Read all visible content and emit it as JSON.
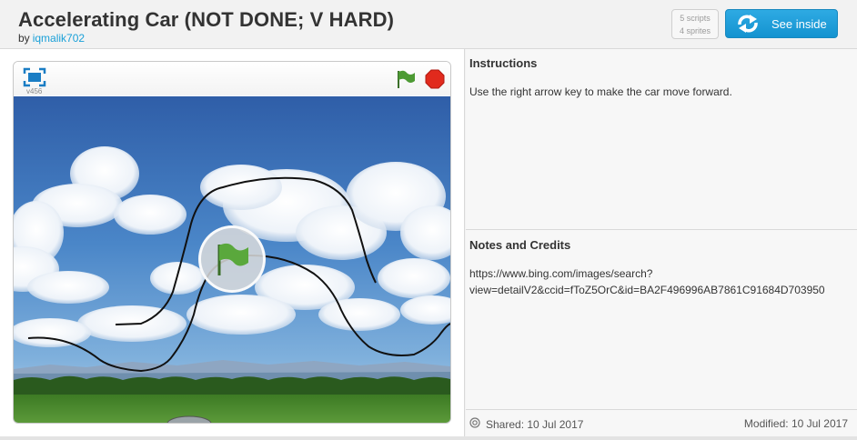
{
  "project": {
    "title": "Accelerating Car (NOT DONE; V HARD)",
    "by_label": "by",
    "author": "iqmalik702",
    "scripts_count": "5 scripts",
    "sprites_count": "4 sprites",
    "see_inside_label": "See inside"
  },
  "player": {
    "version": "v456",
    "icons": {
      "fullscreen": "fullscreen-icon",
      "green_flag": "green-flag-icon",
      "stop": "stop-icon",
      "big_flag": "big-green-flag-icon"
    },
    "colors": {
      "sky_top": "#3e6fb8",
      "grass": "#4f8a2c",
      "flag": "#5aa83c",
      "stop": "#e12a1d"
    }
  },
  "instructions": {
    "title": "Instructions",
    "body": "Use the right arrow key to make the car move forward."
  },
  "notes": {
    "title": "Notes and Credits",
    "line1": "https://www.bing.com/images/search?",
    "line2": "view=detailV2&ccid=fToZ5OrC&id=BA2F496996AB7861C91684D703950"
  },
  "footer": {
    "shared": "Shared: 10 Jul 2017",
    "modified": "Modified: 10 Jul 2017"
  }
}
